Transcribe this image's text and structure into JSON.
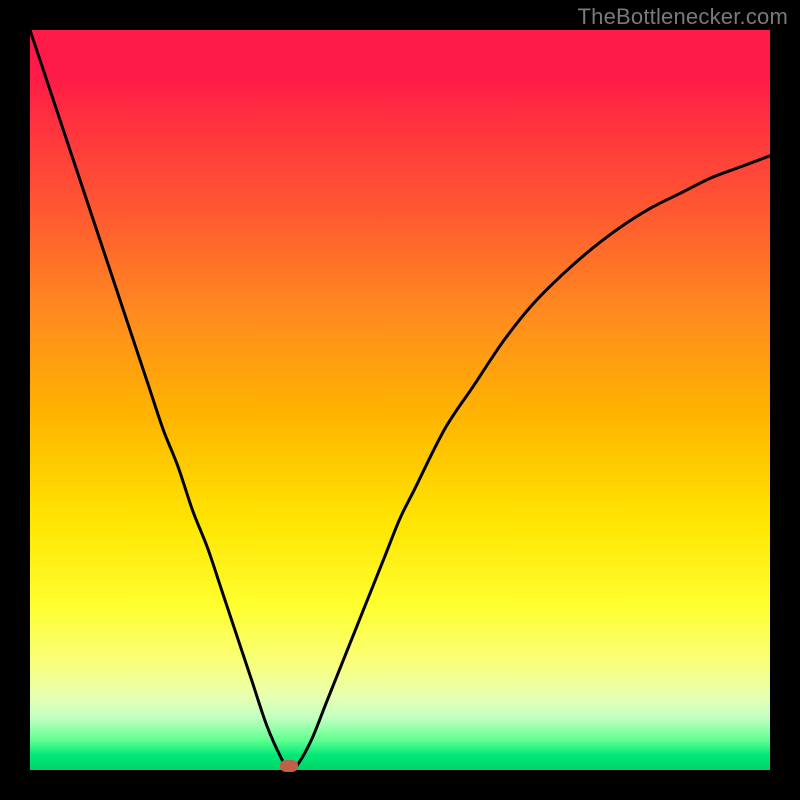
{
  "attribution": "TheBottlenecker.com",
  "colors": {
    "frame": "#000000",
    "curve": "#000000",
    "marker": "#c06048",
    "gradient_top": "#ff1a48",
    "gradient_bottom": "#00d468"
  },
  "chart_data": {
    "type": "line",
    "title": "",
    "xlabel": "",
    "ylabel": "",
    "xlim": [
      0,
      100
    ],
    "ylim": [
      0,
      100
    ],
    "series": [
      {
        "name": "bottleneck-curve",
        "x": [
          0,
          2,
          4,
          6,
          8,
          10,
          12,
          14,
          16,
          18,
          20,
          22,
          24,
          26,
          28,
          30,
          32,
          34,
          35,
          36,
          38,
          40,
          42,
          44,
          46,
          48,
          50,
          52,
          56,
          60,
          64,
          68,
          72,
          76,
          80,
          84,
          88,
          92,
          96,
          100
        ],
        "values": [
          100,
          94,
          88,
          82,
          76,
          70,
          64,
          58,
          52,
          46,
          41,
          35,
          30,
          24,
          18,
          12,
          6,
          1.5,
          0,
          0.5,
          4,
          9,
          14,
          19,
          24,
          29,
          34,
          38,
          46,
          52,
          58,
          63,
          67,
          70.5,
          73.5,
          76,
          78,
          80,
          81.5,
          83
        ]
      }
    ],
    "annotations": [
      {
        "name": "min-marker",
        "x": 35,
        "y": 0
      }
    ]
  }
}
